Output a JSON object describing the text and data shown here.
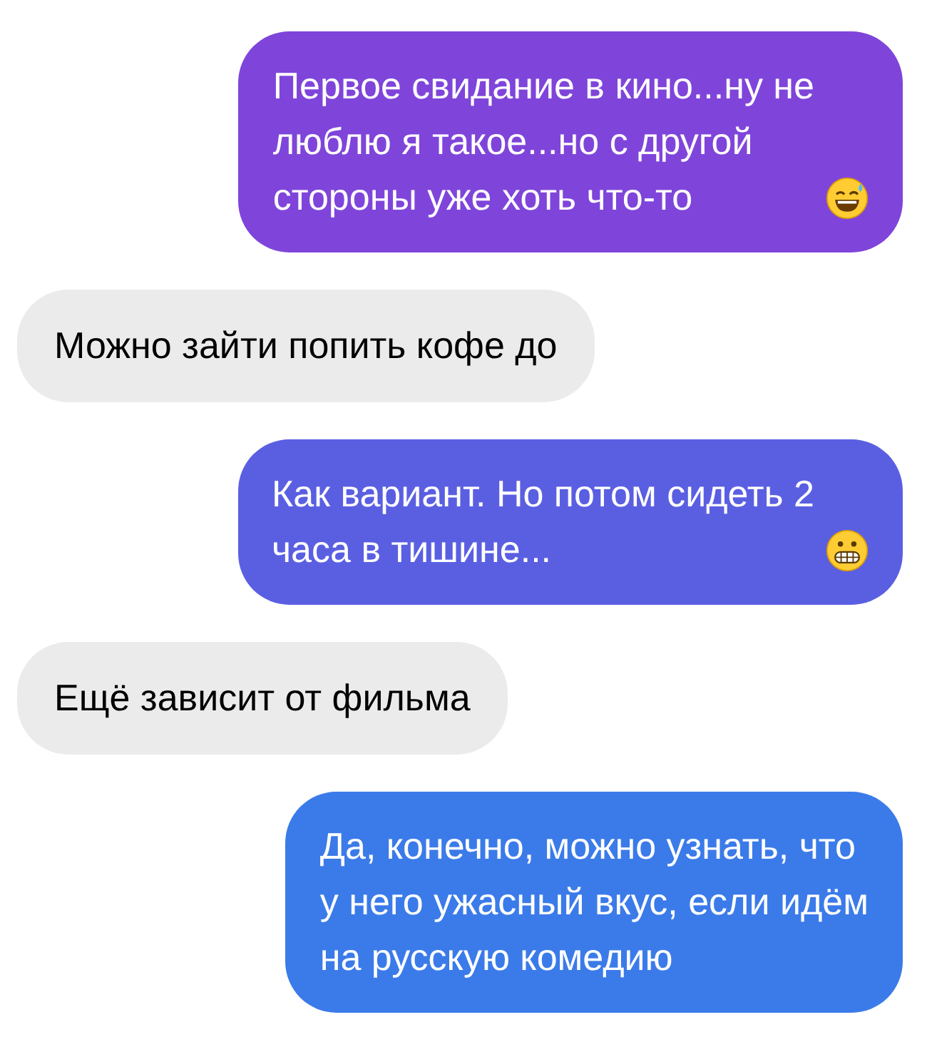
{
  "messages": [
    {
      "kind": "sent",
      "color": "#7f45da",
      "lines": [
        "Первое свидание в кино...ну не",
        "люблю я такое...но с другой",
        "стороны уже хоть что-то"
      ],
      "emoji": {
        "kind": "sweat"
      }
    },
    {
      "kind": "received",
      "lines": [
        "Можно зайти попить кофе до"
      ]
    },
    {
      "kind": "sent",
      "color": "#5a5fe2",
      "lines": [
        "Как вариант. Но потом сидеть 2",
        "часа в тишине..."
      ],
      "emoji": {
        "kind": "grimace"
      }
    },
    {
      "kind": "received",
      "lines": [
        "Ещё зависит от фильма"
      ]
    },
    {
      "kind": "sent",
      "color": "#3b7be9",
      "lines": [
        "Да, конечно, можно узнать, что",
        "у него ужасный вкус, если идём",
        "на русскую комедию"
      ]
    }
  ]
}
